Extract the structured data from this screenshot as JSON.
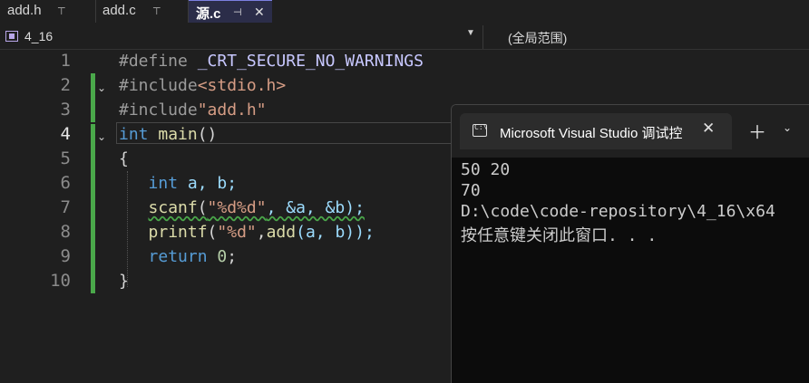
{
  "tabs": [
    {
      "label": "add.h",
      "pin": "⊤"
    },
    {
      "label": "add.c",
      "pin": "⊤"
    },
    {
      "label": "源.c",
      "pin": "⊣",
      "close": "✕"
    }
  ],
  "navbar": {
    "project": "4_16",
    "scope": "(全局范围)"
  },
  "editor": {
    "line_numbers": [
      "1",
      "2",
      "3",
      "4",
      "5",
      "6",
      "7",
      "8",
      "9",
      "10"
    ],
    "current_line": "4",
    "lines": {
      "l1_directive": "#define",
      "l1_macro": "_CRT_SECURE_NO_WARNINGS",
      "l2_directive": "#include",
      "l2_header": "<stdio.h>",
      "l3_directive": "#include",
      "l3_header": "\"add.h\"",
      "l4_type": "int",
      "l4_name": "main",
      "l4_parens": "()",
      "l5_brace": "{",
      "l6_type": "int",
      "l6_vars": "a, b;",
      "l7_fn": "scanf",
      "l7_open": "(",
      "l7_fmt": "\"%d%d\"",
      "l7_rest": ", &a, &b);",
      "l8_fn": "printf",
      "l8_open": "(",
      "l8_fmt": "\"%d\"",
      "l8_comma": ",",
      "l8_call": "add",
      "l8_rest": "(a, b));",
      "l9_kw": "return",
      "l9_num": "0",
      "l9_semi": ";",
      "l10_brace": "}"
    }
  },
  "terminal": {
    "title": "Microsoft Visual Studio 调试控",
    "output": [
      "50 20",
      "70",
      "D:\\code\\code-repository\\4_16\\x64",
      "按任意键关闭此窗口. . ."
    ]
  }
}
